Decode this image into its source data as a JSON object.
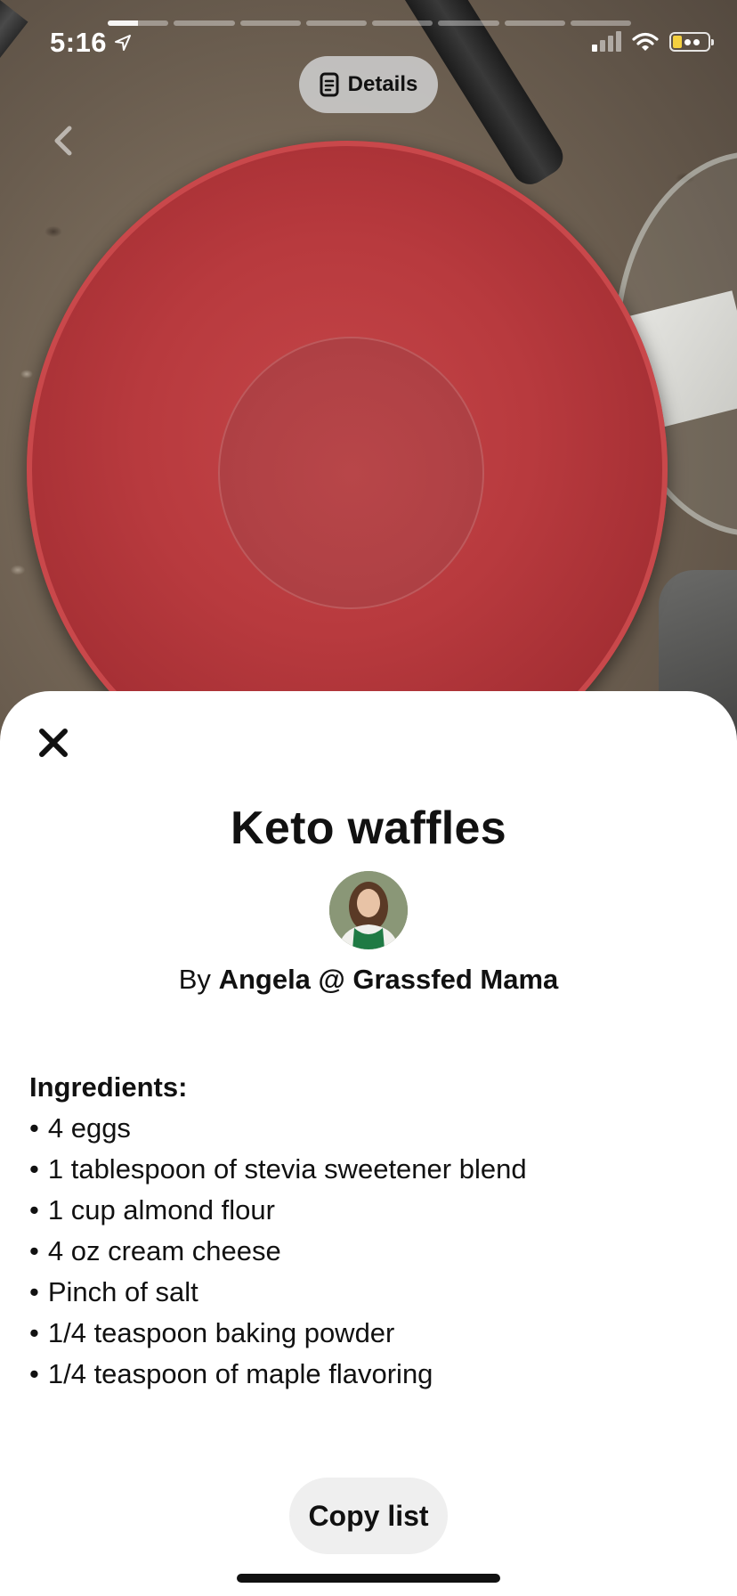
{
  "status_bar": {
    "time": "5:16",
    "signal_bars_on": 1,
    "signal_bars_total": 4,
    "battery_color": "#f4d03f"
  },
  "story": {
    "segment_count": 8,
    "current_segment": 1,
    "current_progress": 0.5
  },
  "header": {
    "details_label": "Details",
    "details_icon": "document-icon",
    "back_icon": "chevron-left-icon"
  },
  "sheet": {
    "close_icon": "close-icon",
    "title": "Keto waffles",
    "byline_prefix": "By",
    "author": "Angela @ Grassfed Mama",
    "ingredients_heading": "Ingredients:",
    "ingredients": [
      "4 eggs",
      "1 tablespoon of stevia sweetener blend",
      "1 cup almond flour",
      "4 oz cream cheese",
      "Pinch of salt",
      "1/4 teaspoon baking powder",
      "1/4 teaspoon of maple flavoring"
    ],
    "copy_label": "Copy list"
  }
}
